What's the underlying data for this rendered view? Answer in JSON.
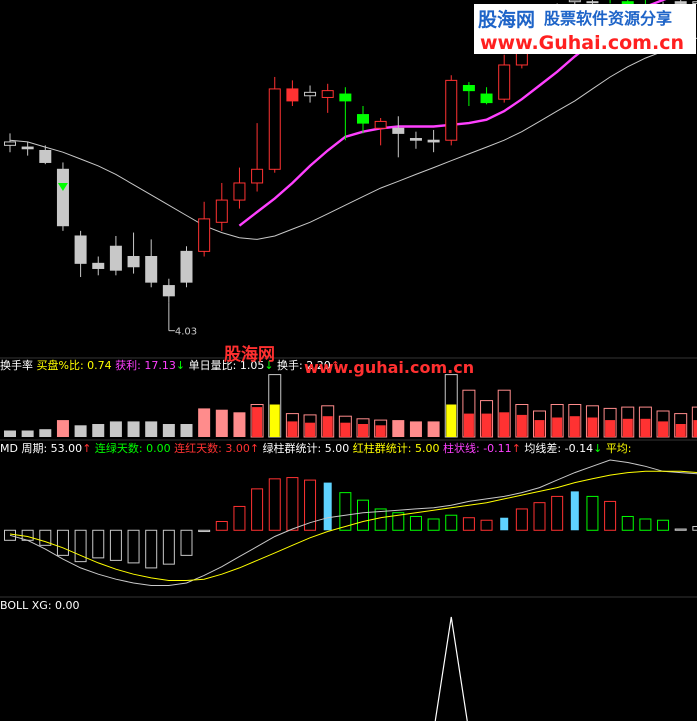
{
  "watermark": {
    "logo": "股海网",
    "tagline": "股票软件资源分享",
    "url": "www.Guhai.com.cn",
    "center_logo": "股海网",
    "center_url": "www.guhai.com.cn"
  },
  "colors": {
    "bg": "#000000",
    "up": "#ff3232",
    "down": "#00ff00",
    "neutral": "#c8c8c8",
    "ma_pink": "#ff40ff",
    "ma_white": "#c8c8c8",
    "yellow": "#ffff00",
    "cyan": "#5fd3ff",
    "pink_bar": "#ff8c8c",
    "grey_bar": "#c8c8c8",
    "sep": "#333333",
    "white": "#ffffff"
  },
  "chart_data": [
    {
      "type": "candlestick",
      "panel": "price",
      "ylim": [
        3.8,
        5.8
      ],
      "annotations": [
        {
          "index": 9,
          "text": "4.03"
        }
      ],
      "candles": [
        {
          "o": 4.95,
          "h": 5.02,
          "l": 4.91,
          "c": 4.97,
          "color": "neutral"
        },
        {
          "o": 4.94,
          "h": 4.97,
          "l": 4.89,
          "c": 4.93,
          "color": "neutral"
        },
        {
          "o": 4.92,
          "h": 4.95,
          "l": 4.84,
          "c": 4.85,
          "color": "neutral"
        },
        {
          "o": 4.81,
          "h": 4.85,
          "l": 4.45,
          "c": 4.48,
          "color": "neutral"
        },
        {
          "o": 4.42,
          "h": 4.45,
          "l": 4.18,
          "c": 4.26,
          "color": "neutral"
        },
        {
          "o": 4.26,
          "h": 4.3,
          "l": 4.19,
          "c": 4.23,
          "color": "neutral"
        },
        {
          "o": 4.36,
          "h": 4.42,
          "l": 4.19,
          "c": 4.22,
          "color": "neutral"
        },
        {
          "o": 4.3,
          "h": 4.44,
          "l": 4.2,
          "c": 4.24,
          "color": "neutral"
        },
        {
          "o": 4.3,
          "h": 4.4,
          "l": 4.12,
          "c": 4.15,
          "color": "neutral"
        },
        {
          "o": 4.13,
          "h": 4.17,
          "l": 4.03,
          "c": 4.07,
          "color": "neutral"
        },
        {
          "o": 4.33,
          "h": 4.36,
          "l": 4.12,
          "c": 4.15,
          "color": "neutral"
        },
        {
          "o": 4.33,
          "h": 4.62,
          "l": 4.3,
          "c": 4.52,
          "color": "up"
        },
        {
          "o": 4.5,
          "h": 4.73,
          "l": 4.45,
          "c": 4.63,
          "color": "up"
        },
        {
          "o": 4.63,
          "h": 4.82,
          "l": 4.58,
          "c": 4.73,
          "color": "up"
        },
        {
          "o": 4.73,
          "h": 5.08,
          "l": 4.68,
          "c": 4.81,
          "color": "up"
        },
        {
          "o": 4.81,
          "h": 5.35,
          "l": 4.79,
          "c": 5.28,
          "color": "up"
        },
        {
          "o": 5.28,
          "h": 5.33,
          "l": 5.18,
          "c": 5.21,
          "color": "up"
        },
        {
          "o": 5.24,
          "h": 5.3,
          "l": 5.2,
          "c": 5.26,
          "color": "neutral"
        },
        {
          "o": 5.23,
          "h": 5.31,
          "l": 5.14,
          "c": 5.27,
          "color": "up"
        },
        {
          "o": 5.25,
          "h": 5.29,
          "l": 4.98,
          "c": 5.21,
          "color": "down"
        },
        {
          "o": 5.13,
          "h": 5.18,
          "l": 5.02,
          "c": 5.08,
          "color": "down"
        },
        {
          "o": 5.05,
          "h": 5.11,
          "l": 4.95,
          "c": 5.09,
          "color": "up"
        },
        {
          "o": 5.05,
          "h": 5.12,
          "l": 4.88,
          "c": 5.02,
          "color": "neutral"
        },
        {
          "o": 4.99,
          "h": 5.03,
          "l": 4.93,
          "c": 4.98,
          "color": "neutral"
        },
        {
          "o": 4.98,
          "h": 5.04,
          "l": 4.91,
          "c": 4.97,
          "color": "neutral"
        },
        {
          "o": 4.98,
          "h": 5.36,
          "l": 4.95,
          "c": 5.33,
          "color": "up"
        },
        {
          "o": 5.3,
          "h": 5.32,
          "l": 5.18,
          "c": 5.27,
          "color": "down"
        },
        {
          "o": 5.25,
          "h": 5.29,
          "l": 5.19,
          "c": 5.2,
          "color": "down"
        },
        {
          "o": 5.22,
          "h": 5.48,
          "l": 5.2,
          "c": 5.42,
          "color": "up"
        },
        {
          "o": 5.42,
          "h": 5.68,
          "l": 5.4,
          "c": 5.64,
          "color": "up"
        },
        {
          "o": 5.63,
          "h": 5.72,
          "l": 5.54,
          "c": 5.72,
          "color": "up"
        },
        {
          "o": 5.74,
          "h": 5.78,
          "l": 5.69,
          "c": 5.75,
          "color": "neutral"
        },
        {
          "o": 5.79,
          "h": 5.82,
          "l": 5.7,
          "c": 5.8,
          "color": "neutral"
        },
        {
          "o": 5.79,
          "h": 5.8,
          "l": 5.72,
          "c": 5.79,
          "color": "neutral"
        },
        {
          "o": 5.82,
          "h": 5.84,
          "l": 5.78,
          "c": 5.83,
          "color": "down"
        },
        {
          "o": 5.79,
          "h": 5.81,
          "l": 5.74,
          "c": 5.76,
          "color": "down"
        },
        {
          "o": 5.77,
          "h": 5.81,
          "l": 5.67,
          "c": 5.71,
          "color": "down"
        },
        {
          "o": 5.73,
          "h": 5.79,
          "l": 5.64,
          "c": 5.68,
          "color": "neutral"
        },
        {
          "o": 5.79,
          "h": 5.82,
          "l": 5.74,
          "c": 5.78,
          "color": "neutral"
        },
        {
          "o": 5.78,
          "h": 5.82,
          "l": 5.74,
          "c": 5.79,
          "color": "neutral"
        }
      ],
      "ma_white": [
        4.98,
        4.97,
        4.94,
        4.91,
        4.87,
        4.83,
        4.78,
        4.72,
        4.66,
        4.6,
        4.54,
        4.48,
        4.44,
        4.41,
        4.4,
        4.42,
        4.46,
        4.5,
        4.55,
        4.6,
        4.65,
        4.7,
        4.74,
        4.78,
        4.82,
        4.86,
        4.9,
        4.94,
        4.98,
        5.03,
        5.09,
        5.15,
        5.21,
        5.28,
        5.35,
        5.41,
        5.46,
        5.5,
        5.54,
        5.58
      ],
      "ma_pink": [
        null,
        null,
        null,
        null,
        null,
        null,
        null,
        null,
        null,
        null,
        null,
        null,
        null,
        4.48,
        4.56,
        4.64,
        4.73,
        4.83,
        4.92,
        5.0,
        5.03,
        5.05,
        5.06,
        5.06,
        5.06,
        5.07,
        5.08,
        5.1,
        5.15,
        5.22,
        5.3,
        5.38,
        5.47,
        5.55,
        5.63,
        5.7,
        5.76,
        5.8,
        5.84,
        5.86
      ],
      "pink_start": 13
    },
    {
      "type": "bar",
      "panel": "turnover",
      "title": "换手率",
      "stats": [
        {
          "name": "买盘%比",
          "value": "0.74",
          "name_color": "#ffff00",
          "value_color": "#ffff00",
          "arrow": ""
        },
        {
          "name": "获利",
          "value": "17.13",
          "name_color": "#ff40ff",
          "value_color": "#ff40ff",
          "arrow": "↓",
          "arrow_color": "#00ff00"
        },
        {
          "name": "单日量比",
          "value": "1.05",
          "name_color": "#ffffff",
          "value_color": "#ffffff",
          "arrow": "↓",
          "arrow_color": "#00ff00"
        },
        {
          "name": "换手",
          "value": "2.20",
          "name_color": "#ffffff",
          "value_color": "#ffffff",
          "arrow": "↑",
          "arrow_color": "#ff3232"
        }
      ],
      "ylim": [
        0,
        5
      ],
      "values": [
        0.5,
        0.5,
        0.6,
        1.3,
        0.9,
        1.0,
        1.2,
        1.2,
        1.2,
        1.0,
        1.0,
        2.2,
        2.1,
        1.9,
        2.5,
        4.8,
        1.8,
        1.7,
        2.4,
        1.6,
        1.4,
        1.3,
        1.3,
        1.2,
        1.2,
        4.8,
        3.6,
        2.8,
        3.6,
        2.5,
        2.0,
        2.5,
        2.5,
        2.4,
        2.2,
        2.3,
        2.3,
        2.0,
        1.8,
        2.3
      ],
      "inner": [
        0.3,
        0.3,
        0.3,
        0.8,
        0.6,
        0.6,
        0.7,
        0.7,
        0.7,
        0.6,
        0.6,
        1.5,
        1.4,
        1.2,
        2.3,
        2.5,
        1.2,
        1.1,
        1.6,
        1.1,
        1.0,
        0.9,
        0.8,
        0.8,
        0.8,
        2.5,
        1.8,
        1.8,
        1.9,
        1.7,
        1.3,
        1.5,
        1.6,
        1.5,
        1.3,
        1.4,
        1.4,
        1.2,
        1.0,
        1.3
      ],
      "inner_color": [
        "grey",
        "grey",
        "grey",
        "pink",
        "grey",
        "grey",
        "grey",
        "grey",
        "grey",
        "grey",
        "grey",
        "pink",
        "pink",
        "pink",
        "red",
        "yellow",
        "red",
        "red",
        "red",
        "red",
        "red",
        "red",
        "pink",
        "pink",
        "pink",
        "yellow",
        "red",
        "red",
        "red",
        "red",
        "red",
        "red",
        "red",
        "red",
        "red",
        "red",
        "red",
        "red",
        "red",
        "red"
      ]
    },
    {
      "type": "bar",
      "panel": "md",
      "title": "MD",
      "stats": [
        {
          "name": "周期",
          "value": "53.00",
          "name_color": "#ffffff",
          "value_color": "#ffffff",
          "arrow": "↑",
          "arrow_color": "#ff3232"
        },
        {
          "name": "连绿天数",
          "value": "0.00",
          "name_color": "#00ff00",
          "value_color": "#00ff00",
          "arrow": ""
        },
        {
          "name": "连红天数",
          "value": "3.00",
          "name_color": "#ff3232",
          "value_color": "#ff3232",
          "arrow": "↑",
          "arrow_color": "#ff3232"
        },
        {
          "name": "绿柱群统计",
          "value": "5.00",
          "name_color": "#ffffff",
          "value_color": "#ffffff",
          "arrow": ""
        },
        {
          "name": "红柱群统计",
          "value": "5.00",
          "name_color": "#ffff00",
          "value_color": "#ffff00",
          "arrow": ""
        },
        {
          "name": "柱状线",
          "value": "-0.11",
          "name_color": "#ff40ff",
          "value_color": "#ff40ff",
          "arrow": "↑",
          "arrow_color": "#ff3232"
        },
        {
          "name": "均线差",
          "value": "-0.14",
          "name_color": "#ffffff",
          "value_color": "#ffffff",
          "arrow": "↓",
          "arrow_color": "#00ff00"
        },
        {
          "name": "平均",
          "value": "",
          "name_color": "#ffff00",
          "value_color": "#ffff00",
          "arrow": ""
        }
      ],
      "ylim": [
        -0.5,
        0.6
      ],
      "values": [
        -0.08,
        -0.08,
        -0.12,
        -0.2,
        -0.25,
        -0.22,
        -0.24,
        -0.26,
        -0.3,
        -0.27,
        -0.2,
        -0.01,
        0.07,
        0.19,
        0.33,
        0.41,
        0.42,
        0.4,
        0.38,
        0.3,
        0.24,
        0.17,
        0.14,
        0.11,
        0.09,
        0.12,
        0.1,
        0.08,
        0.1,
        0.17,
        0.22,
        0.27,
        0.31,
        0.27,
        0.23,
        0.11,
        0.09,
        0.08,
        0.01,
        0.03
      ],
      "bar_color": [
        "grey",
        "grey",
        "grey",
        "grey",
        "grey",
        "grey",
        "grey",
        "grey",
        "grey",
        "grey",
        "grey",
        "grey",
        "red",
        "red",
        "red",
        "red",
        "red",
        "red",
        "cyan",
        "green",
        "green",
        "green",
        "green",
        "green",
        "green",
        "green",
        "red",
        "red",
        "cyan",
        "red",
        "red",
        "red",
        "cyan",
        "green",
        "red",
        "green",
        "green",
        "green",
        "grey",
        "grey"
      ],
      "line_white": [
        -0.04,
        -0.08,
        -0.15,
        -0.23,
        -0.3,
        -0.35,
        -0.39,
        -0.42,
        -0.44,
        -0.44,
        -0.42,
        -0.36,
        -0.29,
        -0.21,
        -0.13,
        -0.05,
        0.01,
        0.06,
        0.1,
        0.12,
        0.14,
        0.15,
        0.16,
        0.17,
        0.18,
        0.2,
        0.23,
        0.25,
        0.27,
        0.3,
        0.34,
        0.4,
        0.46,
        0.51,
        0.56,
        0.54,
        0.51,
        0.47,
        0.46,
        0.45
      ],
      "line_yellow": [
        -0.03,
        -0.05,
        -0.09,
        -0.14,
        -0.2,
        -0.26,
        -0.31,
        -0.35,
        -0.38,
        -0.4,
        -0.4,
        -0.39,
        -0.35,
        -0.3,
        -0.24,
        -0.18,
        -0.12,
        -0.06,
        -0.01,
        0.03,
        0.07,
        0.1,
        0.12,
        0.14,
        0.16,
        0.18,
        0.2,
        0.22,
        0.25,
        0.28,
        0.31,
        0.34,
        0.38,
        0.41,
        0.44,
        0.46,
        0.47,
        0.47,
        0.47,
        0.46
      ]
    },
    {
      "type": "line",
      "panel": "boll",
      "title": "BOLL",
      "stats": [
        {
          "name": "XG",
          "value": "0.00",
          "name_color": "#ffffff",
          "value_color": "#ffffff",
          "arrow": ""
        }
      ],
      "ylim": [
        0,
        1
      ],
      "values": [
        0,
        0,
        0,
        0,
        0,
        0,
        0,
        0,
        0,
        0,
        0,
        0,
        0,
        0,
        0,
        0,
        0,
        0,
        0,
        0,
        0,
        0,
        0,
        0,
        0,
        1,
        0,
        0,
        0,
        0,
        0,
        0,
        0,
        0,
        0,
        0,
        0,
        0,
        0,
        0
      ]
    }
  ]
}
